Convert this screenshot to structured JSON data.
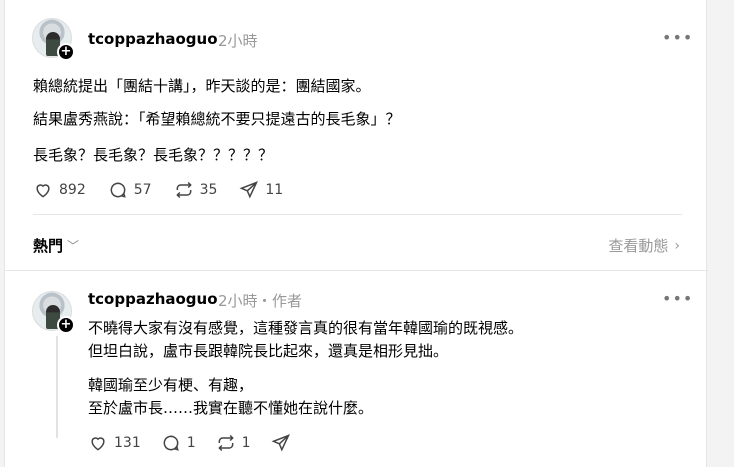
{
  "post": {
    "username": "tcoppazhaoguo",
    "time": "2小時",
    "lines": [
      "賴總統提出「團結十講」，昨天談的是：團結國家。",
      "結果盧秀燕說：「希望賴總統不要只提遠古的長毛象」？",
      "長毛象？長毛象？長毛象？？？？？"
    ],
    "likes": "892",
    "comments": "57",
    "reposts": "35",
    "shares": "11"
  },
  "replies_bar": {
    "sort_label": "熱門",
    "view_activity": "查看動態"
  },
  "reply": {
    "username": "tcoppazhaoguo",
    "time": "2小時",
    "author_tag": "・作者",
    "lines": [
      "不曉得大家有沒有感覺，這種發言真的很有當年韓國瑜的既視感。",
      "但坦白說，盧市長跟韓院長比起來，還真是相形見拙。",
      "韓國瑜至少有梗、有趣，",
      "至於盧市長……我實在聽不懂她在說什麼。"
    ],
    "likes": "131",
    "comments": "1",
    "reposts": "1"
  },
  "icons": {
    "heart": "heart-icon",
    "comment": "comment-icon",
    "repost": "repost-icon",
    "share": "share-icon",
    "more": "more-icon"
  },
  "colors": {
    "background": "#f3f3f3",
    "card": "#ffffff",
    "muted_text": "#999999",
    "icon": "#444444"
  }
}
